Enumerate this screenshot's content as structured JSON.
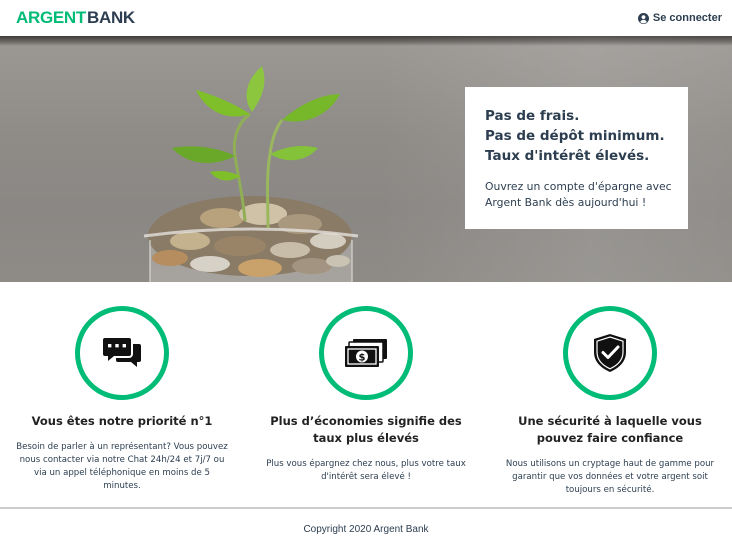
{
  "header": {
    "logo_part1": "ARGENT",
    "logo_part2": "BANK",
    "signin_label": "Se connecter",
    "signin_icon": "user-circle-icon"
  },
  "hero": {
    "subtitles": [
      "Pas de frais.",
      "Pas de dépôt minimum.",
      "Taux d'intérêt élevés."
    ],
    "text": "Ouvrez un compte d'épargne avec Argent Bank dès aujourd'hui !"
  },
  "features": [
    {
      "icon": "chat-icon",
      "title": "Vous êtes notre priorité n°1",
      "text": "Besoin de parler à un représentant? Vous pouvez nous contacter via notre Chat 24h/24 et 7j/7 ou via un appel téléphonique en moins de 5 minutes."
    },
    {
      "icon": "money-icon",
      "title": "Plus d’économies signifie des taux plus élevés",
      "text": "Plus vous épargnez chez nous, plus votre taux d'intérêt sera élevé !"
    },
    {
      "icon": "security-shield-icon",
      "title": "Une sécurité à laquelle vous pouvez faire confiance",
      "text": "Nous utilisons un cryptage haut de gamme pour garantir que vos données et votre argent soit toujours en sécurité."
    }
  ],
  "footer": {
    "copyright": "Copyright 2020 Argent Bank"
  },
  "colors": {
    "accent": "#00bc77",
    "text": "#2c3e50"
  }
}
